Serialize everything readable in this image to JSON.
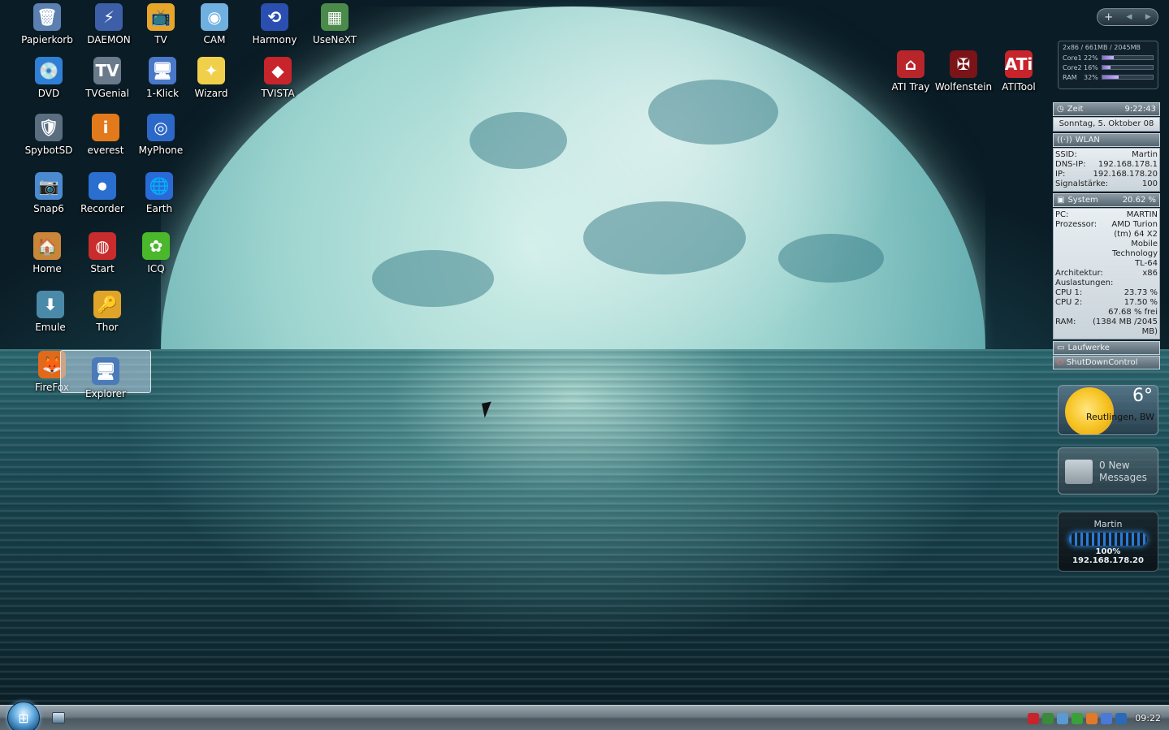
{
  "desktop_icons": [
    {
      "label": "Papierkorb",
      "icon": "recycle-bin-icon",
      "color": "#5a7fb0",
      "glyph": "🗑"
    },
    {
      "label": "DAEMON",
      "icon": "daemon-tools-icon",
      "color": "#3c5fa8",
      "glyph": "⚡"
    },
    {
      "label": "TV",
      "icon": "tv-icon",
      "color": "#e7a52a",
      "glyph": "📺"
    },
    {
      "label": "CAM",
      "icon": "webcam-icon",
      "color": "#6fb0e0",
      "glyph": "◉"
    },
    {
      "label": "Harmony",
      "icon": "harmony-icon",
      "color": "#2a4fb0",
      "glyph": "⟲"
    },
    {
      "label": "UseNeXT",
      "icon": "usenext-icon",
      "color": "#4a8a4a",
      "glyph": "▦"
    },
    {
      "label": "DVD",
      "icon": "dvd-icon",
      "color": "#2f7fd6",
      "glyph": "💿"
    },
    {
      "label": "TVGenial",
      "icon": "tvgenial-icon",
      "color": "#6a7a8a",
      "glyph": "TV"
    },
    {
      "label": "1-Klick",
      "icon": "one-click-icon",
      "color": "#4a78c8",
      "glyph": "🖥"
    },
    {
      "label": "Wizard",
      "icon": "wizard-icon",
      "color": "#f0d04a",
      "glyph": "✦"
    },
    {
      "label": "TVISTA",
      "icon": "tvista-icon",
      "color": "#c8242c",
      "glyph": "◆"
    },
    {
      "label": "SpybotSD",
      "icon": "spybot-icon",
      "color": "#5a6e80",
      "glyph": "🛡"
    },
    {
      "label": "everest",
      "icon": "everest-icon",
      "color": "#e27a1c",
      "glyph": "i"
    },
    {
      "label": "MyPhone",
      "icon": "myphone-icon",
      "color": "#2c68c8",
      "glyph": "◎"
    },
    {
      "label": "Snap6",
      "icon": "snap-icon",
      "color": "#4a8ad0",
      "glyph": "📷"
    },
    {
      "label": "Recorder",
      "icon": "recorder-icon",
      "color": "#2a6fd0",
      "glyph": "⏺"
    },
    {
      "label": "Earth",
      "icon": "google-earth-icon",
      "color": "#2a6ad8",
      "glyph": "🌐"
    },
    {
      "label": "Home",
      "icon": "home-icon",
      "color": "#c8863a",
      "glyph": "🏠"
    },
    {
      "label": "Start",
      "icon": "start-app-icon",
      "color": "#c82c2c",
      "glyph": "◍"
    },
    {
      "label": "ICQ",
      "icon": "icq-icon",
      "color": "#4ab82a",
      "glyph": "✿"
    },
    {
      "label": "Emule",
      "icon": "emule-icon",
      "color": "#4a8aa8",
      "glyph": "⬇"
    },
    {
      "label": "Thor",
      "icon": "key-icon",
      "color": "#e0a42a",
      "glyph": "🔑"
    },
    {
      "label": "FireFox",
      "icon": "firefox-icon",
      "color": "#e06a1a",
      "glyph": "🦊"
    },
    {
      "label": "Explorer",
      "icon": "explorer-icon",
      "color": "#4a7ab8",
      "glyph": "🖥"
    },
    {
      "label": "ATI Tray",
      "icon": "ati-tray-icon",
      "color": "#b8262c",
      "glyph": "⌂"
    },
    {
      "label": "Wolfenstein",
      "icon": "wolfenstein-icon",
      "color": "#7a1418",
      "glyph": "✠"
    },
    {
      "label": "ATITool",
      "icon": "atitool-icon",
      "color": "#c8242c",
      "glyph": "ATi"
    }
  ],
  "cpu_meter": {
    "header": "2x86 / 661MB / 2045MB",
    "rows": [
      {
        "label": "Core1",
        "value": "22%",
        "fill": 22
      },
      {
        "label": "Core2",
        "value": "16%",
        "fill": 16
      },
      {
        "label": "RAM",
        "value": "32%",
        "fill": 32
      }
    ]
  },
  "sidebar": {
    "clock_title": "Zeit",
    "clock_time": "9:22:43",
    "date": "Sonntag, 5. Oktober 08",
    "wlan_title": "WLAN",
    "wlan": [
      {
        "k": "SSID:",
        "v": "Martin"
      },
      {
        "k": "DNS-IP:",
        "v": "192.168.178.1"
      },
      {
        "k": "IP:",
        "v": "192.168.178.20"
      },
      {
        "k": "Signalstärke:",
        "v": "100"
      }
    ],
    "system_title": "System",
    "system_value": "20.62 %",
    "system": [
      {
        "k": "PC:",
        "v": "MARTIN"
      },
      {
        "k": "Prozessor:",
        "v": "AMD Turion (tm) 64 X2 Mobile Technology TL-64"
      },
      {
        "k": "Architektur:",
        "v": "x86"
      },
      {
        "k": "Auslastungen:",
        "v": ""
      },
      {
        "k": "CPU 1:",
        "v": "23.73 %"
      },
      {
        "k": "CPU 2:",
        "v": "17.50 %"
      },
      {
        "k": "",
        "v": "67.68 % frei"
      },
      {
        "k": "RAM:",
        "v": "(1384 MB /2045 MB)"
      }
    ],
    "drives_title": "Laufwerke",
    "shutdown_title": "ShutDownControl"
  },
  "weather": {
    "temp": "6°",
    "city": "Reutlingen, BW"
  },
  "messages": {
    "line1": "0 New",
    "line2": "Messages"
  },
  "wifi": {
    "name": "Martin",
    "strength": "100%",
    "ip": "192.168.178.20"
  },
  "taskbar": {
    "clock": "09:22"
  }
}
